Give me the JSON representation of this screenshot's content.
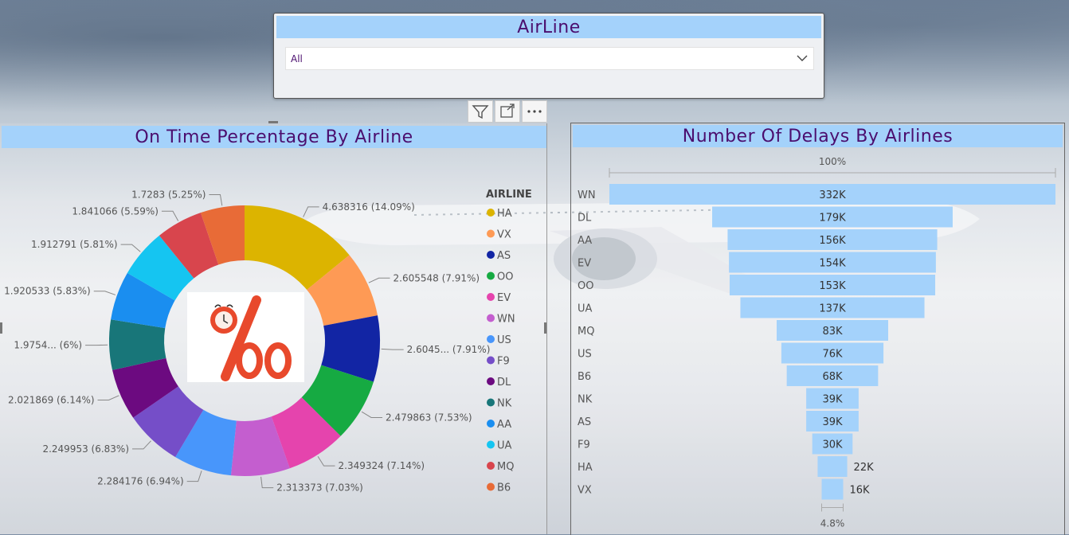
{
  "slicer": {
    "title": "AirLine",
    "value": "All"
  },
  "colors": {
    "header_bg": "#a4d2fb",
    "title_text": "#4b0e6e",
    "bar": "#a4d2fb"
  },
  "visual_header_icons": [
    "filter-icon",
    "focus-mode-icon",
    "more-options-icon"
  ],
  "chart_data": [
    {
      "type": "pie",
      "donut": true,
      "title": "On Time Percentage By Airline",
      "legend_title": "AIRLINE",
      "legend_position": "right",
      "slices": [
        {
          "name": "HA",
          "value": 4.638316,
          "label": "4.638316 (14.09%)",
          "color": "#dcb400"
        },
        {
          "name": "VX",
          "value": 2.605548,
          "label": "2.605548 (7.91%)",
          "color": "#fe9a55"
        },
        {
          "name": "AS",
          "value": 2.6045,
          "label": "2.6045... (7.91%)",
          "color": "#1225a4"
        },
        {
          "name": "OO",
          "value": 2.479863,
          "label": "2.479863 (7.53%)",
          "color": "#16aa42"
        },
        {
          "name": "EV",
          "value": 2.349324,
          "label": "2.349324 (7.14%)",
          "color": "#e544ad"
        },
        {
          "name": "WN",
          "value": 2.313373,
          "label": "2.313373 (7.03%)",
          "color": "#c45ecf"
        },
        {
          "name": "US",
          "value": 2.284176,
          "label": "2.284176 (6.94%)",
          "color": "#4896fb"
        },
        {
          "name": "F9",
          "value": 2.249953,
          "label": "2.249953 (6.83%)",
          "color": "#754ec8"
        },
        {
          "name": "DL",
          "value": 2.021869,
          "label": "2.021869 (6.14%)",
          "color": "#6c0a80"
        },
        {
          "name": "NK",
          "value": 1.9754,
          "label": "1.9754... (6%)",
          "color": "#187679"
        },
        {
          "name": "AA",
          "value": 1.920533,
          "label": "1.920533 (5.83%)",
          "color": "#1a8ef0"
        },
        {
          "name": "UA",
          "value": 1.912791,
          "label": "1.912791 (5.81%)",
          "color": "#15c5f1"
        },
        {
          "name": "MQ",
          "value": 1.841066,
          "label": "1.841066 (5.59%)",
          "color": "#d8454d"
        },
        {
          "name": "B6",
          "value": 1.7283,
          "label": "1.7283 (5.25%)",
          "color": "#e86b37"
        }
      ]
    },
    {
      "type": "bar",
      "orientation": "funnel",
      "title": "Number Of Delays By Airlines",
      "top_label": "100%",
      "bottom_label": "4.8%",
      "categories": [
        "WN",
        "DL",
        "AA",
        "EV",
        "OO",
        "UA",
        "MQ",
        "US",
        "B6",
        "NK",
        "AS",
        "F9",
        "HA",
        "VX"
      ],
      "values": [
        332000,
        179000,
        156000,
        154000,
        153000,
        137000,
        83000,
        76000,
        68000,
        39000,
        39000,
        30000,
        22000,
        16000
      ],
      "labels": [
        "332K",
        "179K",
        "156K",
        "154K",
        "153K",
        "137K",
        "83K",
        "76K",
        "68K",
        "39K",
        "39K",
        "30K",
        "22K",
        "16K"
      ]
    }
  ]
}
